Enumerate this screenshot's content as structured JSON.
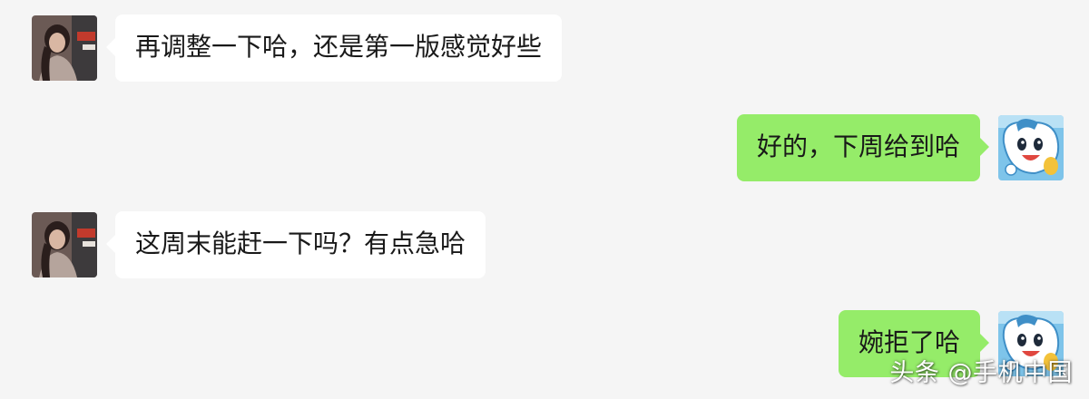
{
  "colors": {
    "background": "#f5f5f5",
    "incoming_bubble": "#ffffff",
    "outgoing_bubble": "#95ec69",
    "text": "#191919"
  },
  "messages": [
    {
      "side": "left",
      "avatar": "user-photo-avatar",
      "text": "再调整一下哈，还是第一版感觉好些"
    },
    {
      "side": "right",
      "avatar": "cartoon-mascot-avatar",
      "text": "好的，下周给到哈"
    },
    {
      "side": "left",
      "avatar": "user-photo-avatar",
      "text": "这周末能赶一下吗？有点急哈"
    },
    {
      "side": "right",
      "avatar": "cartoon-mascot-avatar",
      "text": "婉拒了哈"
    }
  ],
  "watermark": "头条 @手机中国"
}
